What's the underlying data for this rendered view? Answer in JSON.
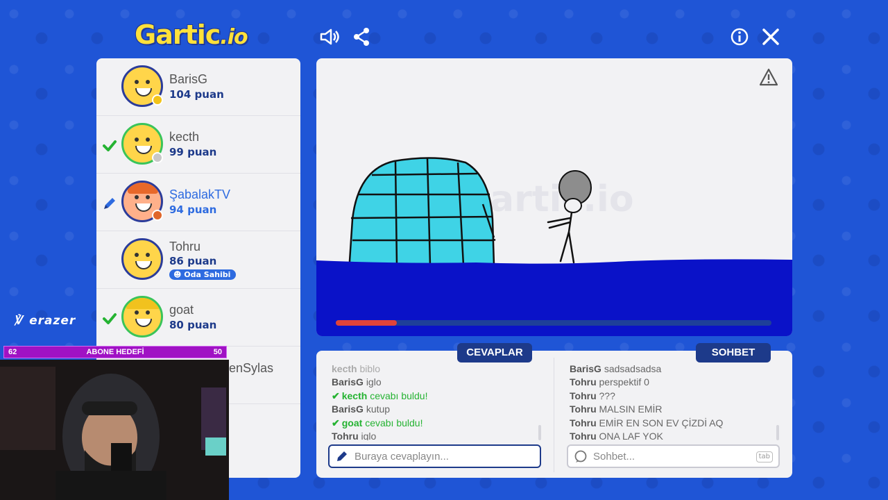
{
  "app": {
    "logo_main": "Gartic",
    "logo_suffix": ".io"
  },
  "icons": {
    "sound": "speaker-icon",
    "share": "share-icon",
    "info": "info-icon",
    "close": "close-icon",
    "report": "warning-icon"
  },
  "players": [
    {
      "name": "BarisG",
      "score": "104 puan",
      "status": "none",
      "dot_color": "#f2c318",
      "avatar": "smile"
    },
    {
      "name": "kecth",
      "score": "99 puan",
      "status": "guessed",
      "dot_color": "#c8c8c8",
      "avatar": "smile"
    },
    {
      "name": "ŞabalakTV",
      "score": "94 puan",
      "status": "drawing",
      "dot_color": "#e0662a",
      "avatar": "redhair"
    },
    {
      "name": "Tohru",
      "score": "86 puan",
      "status": "none",
      "badge": "Oda Sahibi",
      "avatar": "smile"
    },
    {
      "name": "goat",
      "score": "80 puan",
      "status": "guessed",
      "avatar": "cap"
    },
    {
      "name": "enSylas",
      "score": "",
      "status": "none"
    }
  ],
  "round": {
    "time_remaining_fraction": 0.14
  },
  "answers": {
    "tab_label": "CEVAPLAR",
    "placeholder": "Buraya cevaplayın...",
    "messages": [
      {
        "user": "kecth",
        "text": "biblo",
        "type": "faded"
      },
      {
        "user": "BarisG",
        "text": "iglo",
        "type": "normal"
      },
      {
        "user": "kecth",
        "text": "cevabı buldu!",
        "type": "correct"
      },
      {
        "user": "BarisG",
        "text": "kutup",
        "type": "normal"
      },
      {
        "user": "goat",
        "text": "cevabı buldu!",
        "type": "correct"
      },
      {
        "user": "Tohru",
        "text": "iglo",
        "type": "normal"
      }
    ]
  },
  "chat": {
    "tab_label": "SOHBET",
    "placeholder": "Sohbet...",
    "shortcut": "tab",
    "messages": [
      {
        "user": "BarisG",
        "text": "sadsadsadsa"
      },
      {
        "user": "Tohru",
        "text": "perspektif 0"
      },
      {
        "user": "Tohru",
        "text": "???"
      },
      {
        "user": "Tohru",
        "text": "MALSIN EMİR"
      },
      {
        "user": "Tohru",
        "text": "EMİR EN SON EV ÇİZDİ AQ"
      },
      {
        "user": "Tohru",
        "text": "ONA LAF YOK"
      }
    ]
  },
  "overlay": {
    "brand": "erazer",
    "subgoal_left": "62",
    "subgoal_title": "ABONE HEDEFİ",
    "subgoal_right": "50"
  },
  "colors": {
    "background": "#1f55d6",
    "navy": "#1d3a8a",
    "igloo": "#3fd3e6",
    "water": "#0a12c8",
    "correct": "#25b332"
  }
}
